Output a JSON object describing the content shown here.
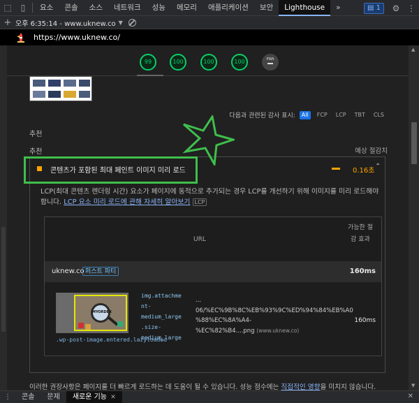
{
  "devtools": {
    "tabs": [
      "요소",
      "콘솔",
      "소스",
      "네트워크",
      "성능",
      "메모리",
      "애플리케이션",
      "보안",
      "Lighthouse"
    ],
    "active_tab": "Lighthouse",
    "more_tabs_icon": "»",
    "messages_count": "1"
  },
  "report_bar": {
    "time_url": "오후 6:35:14 - www.uknew.co",
    "add_icon": "+"
  },
  "url_bar": {
    "url": "https://www.uknew.co/"
  },
  "scores": [
    {
      "name": "performance",
      "value": "99"
    },
    {
      "name": "accessibility",
      "value": "100"
    },
    {
      "name": "best-practices",
      "value": "100"
    },
    {
      "name": "seo",
      "value": "100"
    }
  ],
  "pwa": {
    "label": "PWA"
  },
  "filter": {
    "label": "다음과 관련된 감사 표시:",
    "chips": [
      "All",
      "FCP",
      "LCP",
      "TBT",
      "CLS"
    ],
    "selected": "All"
  },
  "section_labels": {
    "first": "추천",
    "second": "추천",
    "savings_header": "예상 절감치"
  },
  "audit": {
    "title": "콘텐츠가 포함된 최대 페인트 이미지 미리 로드",
    "value": "0.16초",
    "description_text": "LCP(최대 콘텐츠 렌더링 시간) 요소가 페이지에 동적으로 추가되는 경우 LCP를 개선하기 위해 이미지를 미리 로드해야 합니다.",
    "learn_more": "LCP 요소 미리 로드에 관해 자세히 알아보기",
    "tag": "LCP",
    "table": {
      "col_url": "URL",
      "col_savings": "가능한 절감 효과",
      "entity_name": "uknew.co",
      "entity_badge": "퍼스트 파티",
      "entity_value": "160ms",
      "node": {
        "image_caption": "MYORDEX",
        "snippet": [
          "img.attachme",
          "nt-",
          "medium_large",
          ".size-",
          "medium_large"
        ],
        "selector": ".wp-post-image.entered.lazyloaded",
        "url_lines": [
          "...",
          "06/%EC%9B%8C%EB%93%9C%ED%94%84%EB%A0",
          "%88%EC%8A%A4-",
          "%EC%82%B4....png"
        ],
        "url_host": "(www.uknew.co)",
        "value": "160ms"
      }
    }
  },
  "footer": {
    "text": "이러한 권장사항은 페이지를 더 빠르게 로드하는 데 도움이 될 수 있습니다. 성능 점수에는",
    "link": "직접적인 영향",
    "tail": "을 미치지 않습니다."
  },
  "drawer": {
    "tabs": [
      "콘솔",
      "문제",
      "새로운 기능"
    ],
    "active_tab": "새로운 기능"
  },
  "colors": {
    "pass": "#0cce6b",
    "warn": "#ffa400",
    "link": "#8ab4f8",
    "highlight": "#3fbf4c"
  }
}
